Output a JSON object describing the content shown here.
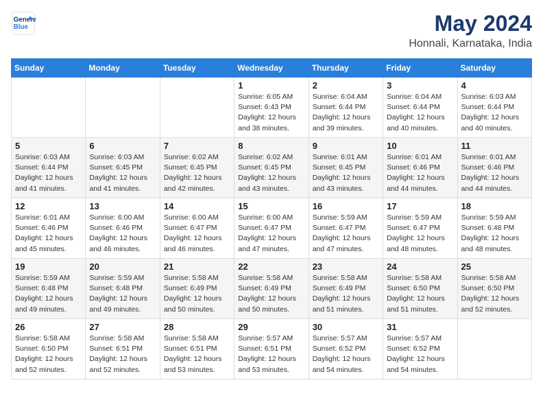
{
  "header": {
    "logo_line1": "General",
    "logo_line2": "Blue",
    "title": "May 2024",
    "subtitle": "Honnali, Karnataka, India"
  },
  "days_of_week": [
    "Sunday",
    "Monday",
    "Tuesday",
    "Wednesday",
    "Thursday",
    "Friday",
    "Saturday"
  ],
  "weeks": [
    {
      "style": "row-white",
      "days": [
        {
          "num": "",
          "info": ""
        },
        {
          "num": "",
          "info": ""
        },
        {
          "num": "",
          "info": ""
        },
        {
          "num": "1",
          "info": "Sunrise: 6:05 AM\nSunset: 6:43 PM\nDaylight: 12 hours\nand 38 minutes."
        },
        {
          "num": "2",
          "info": "Sunrise: 6:04 AM\nSunset: 6:44 PM\nDaylight: 12 hours\nand 39 minutes."
        },
        {
          "num": "3",
          "info": "Sunrise: 6:04 AM\nSunset: 6:44 PM\nDaylight: 12 hours\nand 40 minutes."
        },
        {
          "num": "4",
          "info": "Sunrise: 6:03 AM\nSunset: 6:44 PM\nDaylight: 12 hours\nand 40 minutes."
        }
      ]
    },
    {
      "style": "row-gray",
      "days": [
        {
          "num": "5",
          "info": "Sunrise: 6:03 AM\nSunset: 6:44 PM\nDaylight: 12 hours\nand 41 minutes."
        },
        {
          "num": "6",
          "info": "Sunrise: 6:03 AM\nSunset: 6:45 PM\nDaylight: 12 hours\nand 41 minutes."
        },
        {
          "num": "7",
          "info": "Sunrise: 6:02 AM\nSunset: 6:45 PM\nDaylight: 12 hours\nand 42 minutes."
        },
        {
          "num": "8",
          "info": "Sunrise: 6:02 AM\nSunset: 6:45 PM\nDaylight: 12 hours\nand 43 minutes."
        },
        {
          "num": "9",
          "info": "Sunrise: 6:01 AM\nSunset: 6:45 PM\nDaylight: 12 hours\nand 43 minutes."
        },
        {
          "num": "10",
          "info": "Sunrise: 6:01 AM\nSunset: 6:46 PM\nDaylight: 12 hours\nand 44 minutes."
        },
        {
          "num": "11",
          "info": "Sunrise: 6:01 AM\nSunset: 6:46 PM\nDaylight: 12 hours\nand 44 minutes."
        }
      ]
    },
    {
      "style": "row-white",
      "days": [
        {
          "num": "12",
          "info": "Sunrise: 6:01 AM\nSunset: 6:46 PM\nDaylight: 12 hours\nand 45 minutes."
        },
        {
          "num": "13",
          "info": "Sunrise: 6:00 AM\nSunset: 6:46 PM\nDaylight: 12 hours\nand 46 minutes."
        },
        {
          "num": "14",
          "info": "Sunrise: 6:00 AM\nSunset: 6:47 PM\nDaylight: 12 hours\nand 46 minutes."
        },
        {
          "num": "15",
          "info": "Sunrise: 6:00 AM\nSunset: 6:47 PM\nDaylight: 12 hours\nand 47 minutes."
        },
        {
          "num": "16",
          "info": "Sunrise: 5:59 AM\nSunset: 6:47 PM\nDaylight: 12 hours\nand 47 minutes."
        },
        {
          "num": "17",
          "info": "Sunrise: 5:59 AM\nSunset: 6:47 PM\nDaylight: 12 hours\nand 48 minutes."
        },
        {
          "num": "18",
          "info": "Sunrise: 5:59 AM\nSunset: 6:48 PM\nDaylight: 12 hours\nand 48 minutes."
        }
      ]
    },
    {
      "style": "row-gray",
      "days": [
        {
          "num": "19",
          "info": "Sunrise: 5:59 AM\nSunset: 6:48 PM\nDaylight: 12 hours\nand 49 minutes."
        },
        {
          "num": "20",
          "info": "Sunrise: 5:59 AM\nSunset: 6:48 PM\nDaylight: 12 hours\nand 49 minutes."
        },
        {
          "num": "21",
          "info": "Sunrise: 5:58 AM\nSunset: 6:49 PM\nDaylight: 12 hours\nand 50 minutes."
        },
        {
          "num": "22",
          "info": "Sunrise: 5:58 AM\nSunset: 6:49 PM\nDaylight: 12 hours\nand 50 minutes."
        },
        {
          "num": "23",
          "info": "Sunrise: 5:58 AM\nSunset: 6:49 PM\nDaylight: 12 hours\nand 51 minutes."
        },
        {
          "num": "24",
          "info": "Sunrise: 5:58 AM\nSunset: 6:50 PM\nDaylight: 12 hours\nand 51 minutes."
        },
        {
          "num": "25",
          "info": "Sunrise: 5:58 AM\nSunset: 6:50 PM\nDaylight: 12 hours\nand 52 minutes."
        }
      ]
    },
    {
      "style": "row-white",
      "days": [
        {
          "num": "26",
          "info": "Sunrise: 5:58 AM\nSunset: 6:50 PM\nDaylight: 12 hours\nand 52 minutes."
        },
        {
          "num": "27",
          "info": "Sunrise: 5:58 AM\nSunset: 6:51 PM\nDaylight: 12 hours\nand 52 minutes."
        },
        {
          "num": "28",
          "info": "Sunrise: 5:58 AM\nSunset: 6:51 PM\nDaylight: 12 hours\nand 53 minutes."
        },
        {
          "num": "29",
          "info": "Sunrise: 5:57 AM\nSunset: 6:51 PM\nDaylight: 12 hours\nand 53 minutes."
        },
        {
          "num": "30",
          "info": "Sunrise: 5:57 AM\nSunset: 6:52 PM\nDaylight: 12 hours\nand 54 minutes."
        },
        {
          "num": "31",
          "info": "Sunrise: 5:57 AM\nSunset: 6:52 PM\nDaylight: 12 hours\nand 54 minutes."
        },
        {
          "num": "",
          "info": ""
        }
      ]
    }
  ]
}
